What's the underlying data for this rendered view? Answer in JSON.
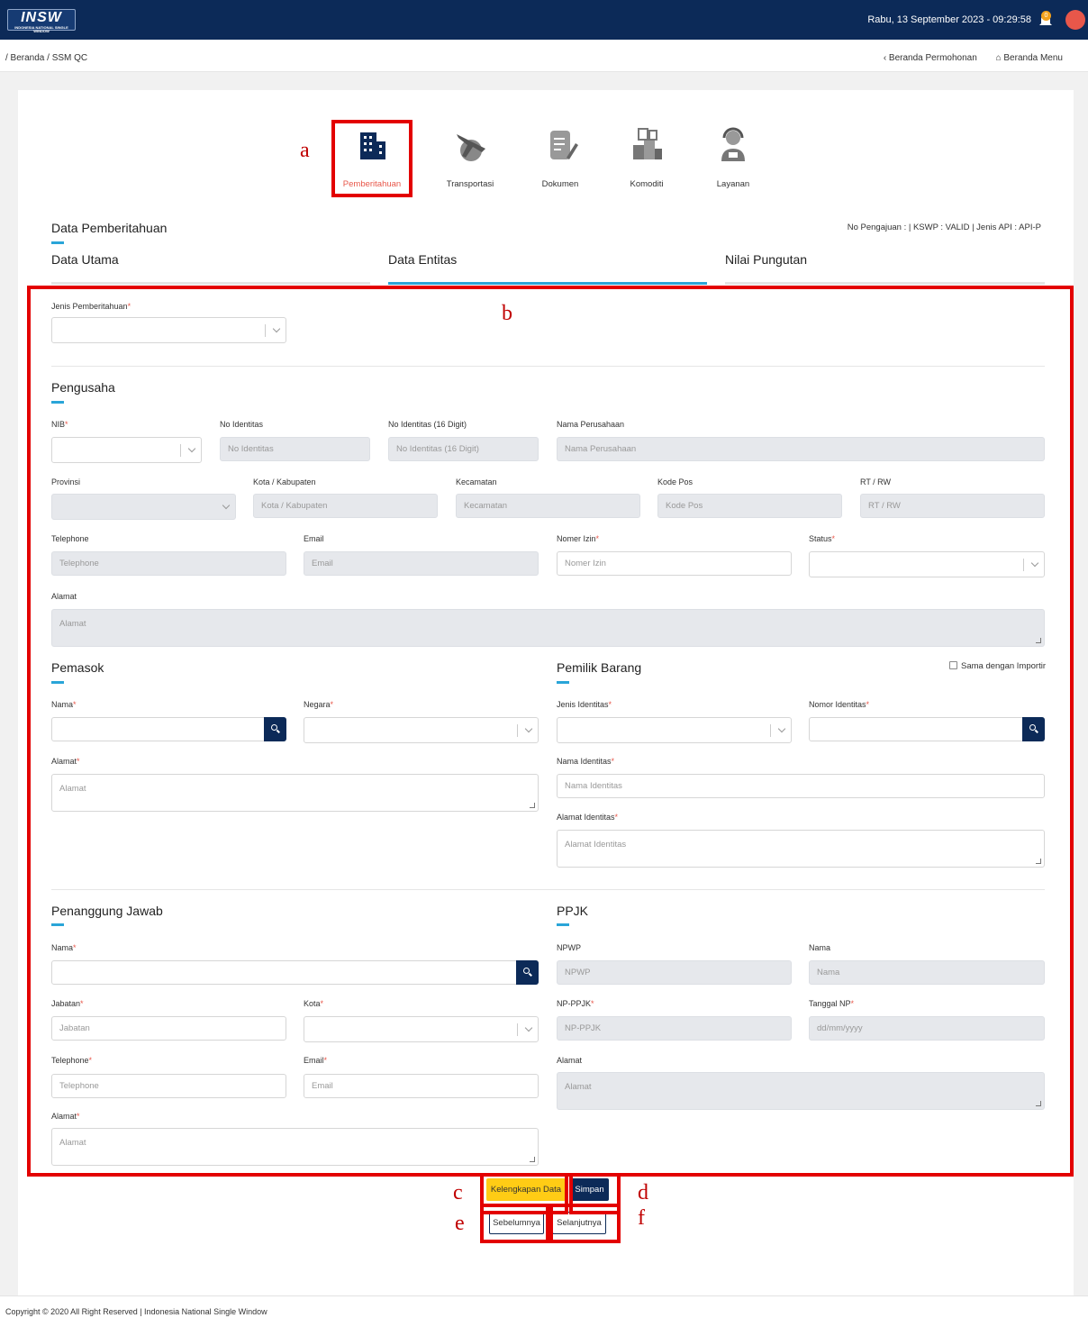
{
  "header": {
    "logo_text": "INSW",
    "logo_subtext": "INDONESIA NATIONAL SINGLE WINDOW",
    "datetime": "Rabu, 13 September 2023 - 09:29:58",
    "notification_count": "0"
  },
  "breadcrumb": "/ Beranda / SSM QC",
  "nav": {
    "back_label": "Beranda Permohonan",
    "home_label": "Beranda Menu"
  },
  "steps": [
    {
      "label": "Pemberitahuan",
      "icon": "building-icon",
      "active": true
    },
    {
      "label": "Transportasi",
      "icon": "airplane-globe-icon",
      "active": false
    },
    {
      "label": "Dokumen",
      "icon": "document-icon",
      "active": false
    },
    {
      "label": "Komoditi",
      "icon": "boxes-icon",
      "active": false
    },
    {
      "label": "Layanan",
      "icon": "customer-service-icon",
      "active": false
    }
  ],
  "annotations": {
    "a": "a",
    "b": "b",
    "c": "c",
    "d": "d",
    "e": "e",
    "f": "f"
  },
  "section_title": "Data Pemberitahuan",
  "info_line": "No Pengajuan : | KSWP : VALID | Jenis API : API-P",
  "tabs": [
    "Data Utama",
    "Data Entitas",
    "Nilai Pungutan"
  ],
  "jenis_label": "Jenis Pemberitahuan",
  "pengusaha": {
    "title": "Pengusaha",
    "nib_label": "NIB",
    "no_identitas_label": "No Identitas",
    "no_identitas_ph": "No Identitas",
    "no_identitas16_label": "No Identitas (16 Digit)",
    "no_identitas16_ph": "No Identitas (16 Digit)",
    "nama_perusahaan_label": "Nama Perusahaan",
    "nama_perusahaan_ph": "Nama Perusahaan",
    "provinsi_label": "Provinsi",
    "kota_label": "Kota / Kabupaten",
    "kota_ph": "Kota / Kabupaten",
    "kecamatan_label": "Kecamatan",
    "kecamatan_ph": "Kecamatan",
    "kodepos_label": "Kode Pos",
    "kodepos_ph": "Kode Pos",
    "rtrw_label": "RT / RW",
    "rtrw_ph": "RT / RW",
    "telephone_label": "Telephone",
    "telephone_ph": "Telephone",
    "email_label": "Email",
    "email_ph": "Email",
    "nomer_izin_label": "Nomer Izin",
    "nomer_izin_ph": "Nomer Izin",
    "status_label": "Status",
    "alamat_label": "Alamat",
    "alamat_ph": "Alamat"
  },
  "pemasok": {
    "title": "Pemasok",
    "nama_label": "Nama",
    "negara_label": "Negara",
    "alamat_label": "Alamat",
    "alamat_ph": "Alamat"
  },
  "pemilik": {
    "title": "Pemilik Barang",
    "same_label": "Sama dengan Importir",
    "jenis_label": "Jenis Identitas",
    "nomor_label": "Nomor Identitas",
    "nama_label": "Nama Identitas",
    "nama_ph": "Nama Identitas",
    "alamat_label": "Alamat Identitas",
    "alamat_ph": "Alamat Identitas"
  },
  "penanggung": {
    "title": "Penanggung Jawab",
    "nama_label": "Nama",
    "jabatan_label": "Jabatan",
    "jabatan_ph": "Jabatan",
    "kota_label": "Kota",
    "telephone_label": "Telephone",
    "telephone_ph": "Telephone",
    "email_label": "Email",
    "email_ph": "Email",
    "alamat_label": "Alamat",
    "alamat_ph": "Alamat"
  },
  "ppjk": {
    "title": "PPJK",
    "npwp_label": "NPWP",
    "npwp_ph": "NPWP",
    "nama_label": "Nama",
    "nama_ph": "Nama",
    "npppjk_label": "NP-PPJK",
    "npppjk_ph": "NP-PPJK",
    "tanggal_label": "Tanggal NP",
    "tanggal_ph": "dd/mm/yyyy",
    "alamat_label": "Alamat",
    "alamat_ph": "Alamat"
  },
  "buttons": {
    "kelengkapan": "Kelengkapan Data",
    "simpan": "Simpan",
    "sebelumnya": "Sebelumnya",
    "selanjutnya": "Selanjutnya"
  },
  "footer": "Copyright © 2020 All Right Reserved | Indonesia National Single Window",
  "colors": {
    "navy": "#0c2a58",
    "accent": "#2aa5d8",
    "active": "#e8574a",
    "yellow": "#ffcc15",
    "annotation": "#e30000"
  }
}
